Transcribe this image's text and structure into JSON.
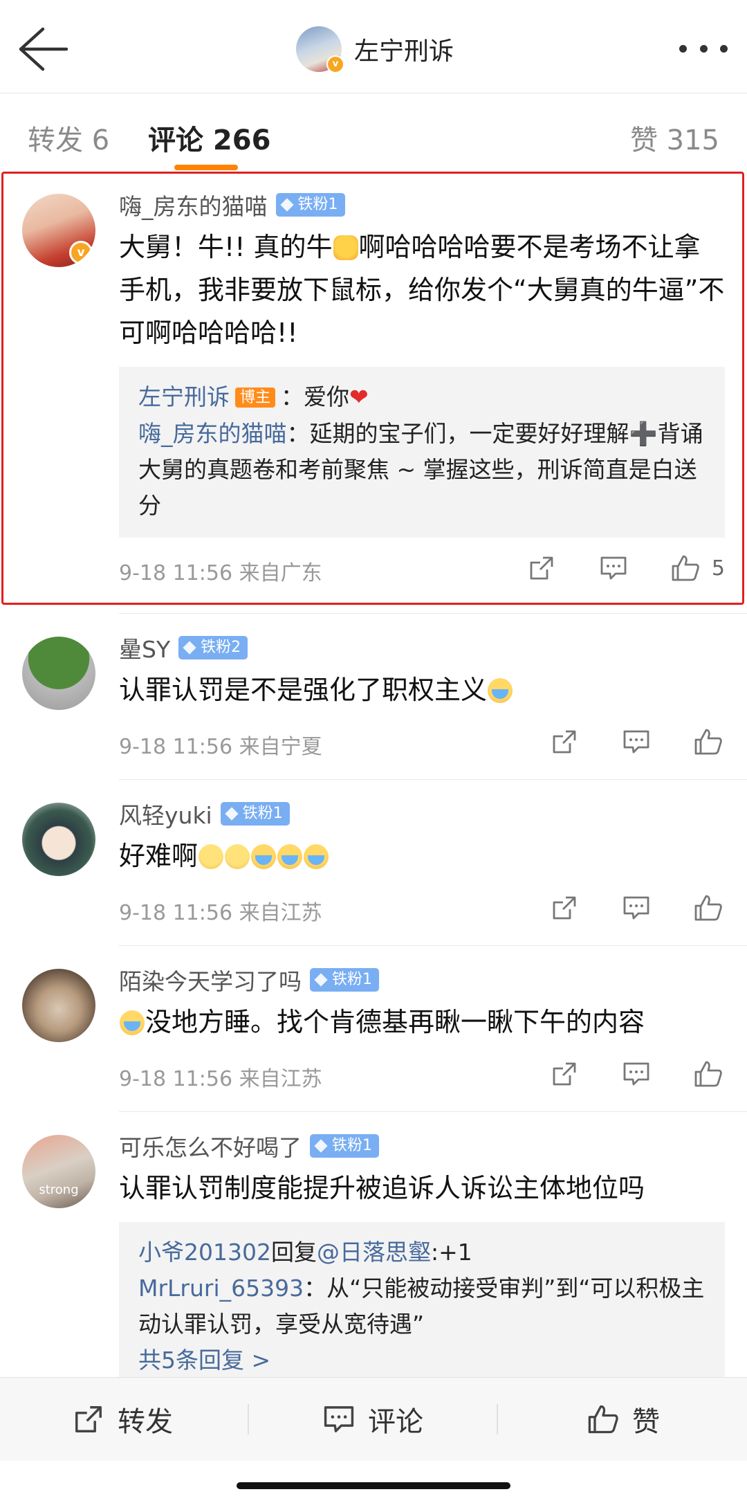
{
  "header": {
    "title": "左宁刑诉",
    "back_icon": "back-arrow-icon",
    "more_icon": "more-dots-icon"
  },
  "tabs": {
    "repost": "转发 6",
    "comments": "评论 266",
    "likes": "赞 315"
  },
  "comments": [
    {
      "user": "嗨_房东的猫喵",
      "badge": "铁粉1",
      "text_a": "大舅！牛!! 真的牛",
      "text_b": "啊哈哈哈哈要不是考场不让拿手机，我非要放下鼠标，给你发个“大舅真的牛逼”不可啊哈哈哈哈!!",
      "replies": {
        "r1_user": "左宁刑诉",
        "r1_tag": "博主",
        "r1_text": "：爱你",
        "r2_user": "嗨_房东的猫喵",
        "r2_text": "：延期的宝子们，一定要好好理解➕背诵大舅的真题卷和考前聚焦 ~ 掌握这些，刑诉简直是白送分"
      },
      "time": "9-18 11:56  来自广东",
      "likes": "5"
    },
    {
      "user": "曐SY",
      "badge": "铁粉2",
      "text": "认罪认罚是不是强化了职权主义",
      "time": "9-18 11:56  来自宁夏"
    },
    {
      "user": "风轻yuki",
      "badge": "铁粉1",
      "text": "好难啊",
      "time": "9-18 11:56  来自江苏"
    },
    {
      "user": "陌染今天学习了吗",
      "badge": "铁粉1",
      "text": "没地方睡。找个肯德基再瞅一瞅下午的内容",
      "time": "9-18 11:56  来自江苏"
    },
    {
      "user": "可乐怎么不好喝了",
      "badge": "铁粉1",
      "text": "认罪认罚制度能提升被追诉人诉讼主体地位吗",
      "avatar_text": "strong",
      "replies": {
        "r1_user": "小爷201302",
        "r1_mid": "回复",
        "r1_at": "@日落思壑",
        "r1_text": ":+1",
        "r2_user": "MrLruri_65393",
        "r2_text": "：从“只能被动接受审判”到“可以积极主动认罪认罚，享受从宽待遇”",
        "more": "共5条回复 >"
      }
    }
  ],
  "bottom": {
    "repost": "转发",
    "comment": "评论",
    "like": "赞"
  },
  "colors": {
    "accent": "#ff8200",
    "link": "#476a9b",
    "fan_badge": "#79aef3",
    "highlight": "#e02020"
  }
}
